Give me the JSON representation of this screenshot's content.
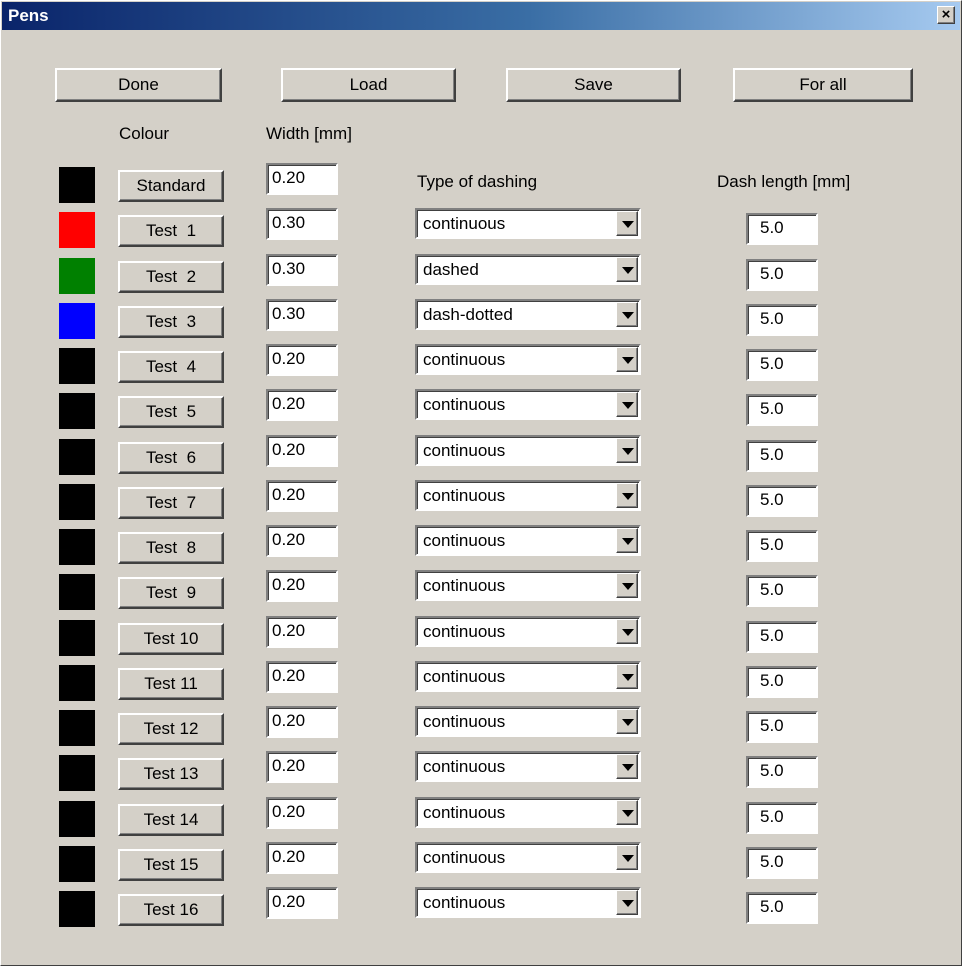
{
  "window": {
    "title": "Pens",
    "close_label": "×"
  },
  "toolbar": {
    "done_label": "Done",
    "load_label": "Load",
    "save_label": "Save",
    "for_all_label": "For all"
  },
  "headers": {
    "colour": "Colour",
    "width": "Width [mm]",
    "dashing": "Type of dashing",
    "dash_length": "Dash length [mm]"
  },
  "colors": {
    "black": "#000000",
    "red": "#ff0000",
    "green": "#008000",
    "blue": "#0000ff"
  },
  "pens": [
    {
      "name": "Standard",
      "color": "#000000",
      "width": "0.20"
    },
    {
      "name": "Test  1",
      "color": "#ff0000",
      "width": "0.30",
      "dashing": "continuous",
      "dash_length": "5.0"
    },
    {
      "name": "Test  2",
      "color": "#008000",
      "width": "0.30",
      "dashing": "dashed",
      "dash_length": "5.0"
    },
    {
      "name": "Test  3",
      "color": "#0000ff",
      "width": "0.30",
      "dashing": "dash-dotted",
      "dash_length": "5.0"
    },
    {
      "name": "Test  4",
      "color": "#000000",
      "width": "0.20",
      "dashing": "continuous",
      "dash_length": "5.0"
    },
    {
      "name": "Test  5",
      "color": "#000000",
      "width": "0.20",
      "dashing": "continuous",
      "dash_length": "5.0"
    },
    {
      "name": "Test  6",
      "color": "#000000",
      "width": "0.20",
      "dashing": "continuous",
      "dash_length": "5.0"
    },
    {
      "name": "Test  7",
      "color": "#000000",
      "width": "0.20",
      "dashing": "continuous",
      "dash_length": "5.0"
    },
    {
      "name": "Test  8",
      "color": "#000000",
      "width": "0.20",
      "dashing": "continuous",
      "dash_length": "5.0"
    },
    {
      "name": "Test  9",
      "color": "#000000",
      "width": "0.20",
      "dashing": "continuous",
      "dash_length": "5.0"
    },
    {
      "name": "Test 10",
      "color": "#000000",
      "width": "0.20",
      "dashing": "continuous",
      "dash_length": "5.0"
    },
    {
      "name": "Test 11",
      "color": "#000000",
      "width": "0.20",
      "dashing": "continuous",
      "dash_length": "5.0"
    },
    {
      "name": "Test 12",
      "color": "#000000",
      "width": "0.20",
      "dashing": "continuous",
      "dash_length": "5.0"
    },
    {
      "name": "Test 13",
      "color": "#000000",
      "width": "0.20",
      "dashing": "continuous",
      "dash_length": "5.0"
    },
    {
      "name": "Test 14",
      "color": "#000000",
      "width": "0.20",
      "dashing": "continuous",
      "dash_length": "5.0"
    },
    {
      "name": "Test 15",
      "color": "#000000",
      "width": "0.20",
      "dashing": "continuous",
      "dash_length": "5.0"
    },
    {
      "name": "Test 16",
      "color": "#000000",
      "width": "0.20",
      "dashing": "continuous",
      "dash_length": "5.0"
    }
  ]
}
